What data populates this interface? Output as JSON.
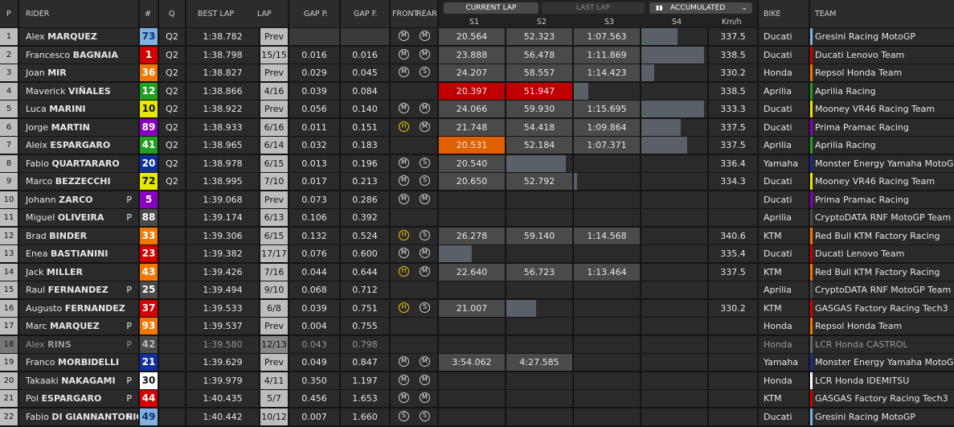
{
  "header": {
    "pos": "P",
    "rider": "RIDER",
    "num": "#",
    "q": "Q",
    "best_lap": "BEST LAP",
    "lap": "LAP",
    "gap_p": "GAP P.",
    "gap_f": "GAP F.",
    "front": "FRONT",
    "rear": "REAR",
    "tab_current": "CURRENT LAP",
    "tab_last": "LAST LAP",
    "accumulated": "ACCUMULATED",
    "s1": "S1",
    "s2": "S2",
    "s3": "S3",
    "s4": "S4",
    "kmh": "Km/h",
    "bike": "BIKE",
    "team": "TEAM"
  },
  "rows": [
    {
      "p": "1",
      "first": "Alex",
      "last": "MARQUEZ",
      "pit": "",
      "num": "73",
      "num_bg": "#7fb2e0",
      "num_fg": "#10306a",
      "q": "Q2",
      "best": "1:38.782",
      "lap": "Prev",
      "gap_p": "",
      "gap_f": "",
      "front": "M",
      "rear": "M",
      "s1": "20.564",
      "s2": "52.323",
      "s3": "1:07.563",
      "s4_pct": 0.55,
      "kmh": "337.5",
      "bike": "Ducati",
      "team": "Gresini Racing MotoGP",
      "team_color": "#7fb2e0"
    },
    {
      "p": "2",
      "first": "Francesco",
      "last": "BAGNAIA",
      "pit": "",
      "num": "1",
      "num_bg": "#d40000",
      "num_fg": "#ffffff",
      "q": "Q2",
      "best": "1:38.798",
      "lap": "15/15",
      "gap_p": "0.016",
      "gap_f": "0.016",
      "front": "M",
      "rear": "M",
      "s1": "23.888",
      "s2": "56.478",
      "s3": "1:11.869",
      "s4_pct": 0.95,
      "kmh": "338.5",
      "bike": "Ducati",
      "team": "Ducati Lenovo Team",
      "team_color": "#d40000"
    },
    {
      "p": "3",
      "first": "Joan",
      "last": "MIR",
      "pit": "",
      "num": "36",
      "num_bg": "#f07800",
      "num_fg": "#ffffff",
      "q": "Q2",
      "best": "1:38.827",
      "lap": "Prev",
      "gap_p": "0.029",
      "gap_f": "0.045",
      "front": "M",
      "rear": "S",
      "s1": "24.207",
      "s2": "58.557",
      "s3": "1:14.423",
      "s4_pct": 0.2,
      "kmh": "330.2",
      "bike": "Honda",
      "team": "Repsol Honda Team",
      "team_color": "#f07800"
    },
    {
      "p": "4",
      "first": "Maverick",
      "last": "VIÑALES",
      "pit": "",
      "num": "12",
      "num_bg": "#20a020",
      "num_fg": "#ffffff",
      "q": "Q2",
      "best": "1:38.866",
      "lap": "4/16",
      "gap_p": "0.039",
      "gap_f": "0.084",
      "front": "",
      "rear": "",
      "s1": "20.397",
      "s2": "51.947",
      "s3": "",
      "s4_pct": 0,
      "s3_bar": 0.22,
      "s1_hl": "#c00000",
      "s2_hl": "#c00000",
      "kmh": "338.5",
      "bike": "Aprilia",
      "team": "Aprilia Racing",
      "team_color": "#20a020"
    },
    {
      "p": "5",
      "first": "Luca",
      "last": "MARINI",
      "pit": "",
      "num": "10",
      "num_bg": "#e6e600",
      "num_fg": "#111111",
      "q": "Q2",
      "best": "1:38.922",
      "lap": "Prev",
      "gap_p": "0.056",
      "gap_f": "0.140",
      "front": "M",
      "rear": "M",
      "s1": "24.066",
      "s2": "59.930",
      "s3": "1:15.695",
      "s4_pct": 0.95,
      "kmh": "333.3",
      "bike": "Ducati",
      "team": "Mooney VR46 Racing Team",
      "team_color": "#e6e600"
    },
    {
      "p": "6",
      "first": "Jorge",
      "last": "MARTIN",
      "pit": "",
      "num": "89",
      "num_bg": "#8a00c0",
      "num_fg": "#ffffff",
      "q": "Q2",
      "best": "1:38.933",
      "lap": "6/16",
      "gap_p": "0.011",
      "gap_f": "0.151",
      "front": "H",
      "rear": "M",
      "s1": "21.748",
      "s2": "54.418",
      "s3": "1:09.864",
      "s4_pct": 0.6,
      "kmh": "337.5",
      "bike": "Ducati",
      "team": "Prima Pramac Racing",
      "team_color": "#8a00c0"
    },
    {
      "p": "7",
      "first": "Aleix",
      "last": "ESPARGARO",
      "pit": "",
      "num": "41",
      "num_bg": "#20a020",
      "num_fg": "#ffffff",
      "q": "Q2",
      "best": "1:38.965",
      "lap": "6/14",
      "gap_p": "0.032",
      "gap_f": "0.183",
      "front": "",
      "rear": "",
      "s1": "20.531",
      "s2": "52.184",
      "s3": "1:07.371",
      "s4_pct": 0.7,
      "s1_hl": "#e06000",
      "kmh": "337.5",
      "bike": "Aprilia",
      "team": "Aprilia Racing",
      "team_color": "#20a020"
    },
    {
      "p": "8",
      "first": "Fabio",
      "last": "QUARTARARO",
      "pit": "",
      "num": "20",
      "num_bg": "#1030a0",
      "num_fg": "#ffffff",
      "q": "Q2",
      "best": "1:38.978",
      "lap": "6/15",
      "gap_p": "0.013",
      "gap_f": "0.196",
      "front": "M",
      "rear": "S",
      "s1": "20.540",
      "s2": "",
      "s3": "",
      "s4_pct": 0,
      "s2_bar": 0.9,
      "kmh": "336.4",
      "bike": "Yamaha",
      "team": "Monster Energy Yamaha MotoGP",
      "team_color": "#1030a0"
    },
    {
      "p": "9",
      "first": "Marco",
      "last": "BEZZECCHI",
      "pit": "",
      "num": "72",
      "num_bg": "#e6e600",
      "num_fg": "#111111",
      "q": "Q2",
      "best": "1:38.995",
      "lap": "7/10",
      "gap_p": "0.017",
      "gap_f": "0.213",
      "front": "M",
      "rear": "S",
      "s1": "20.650",
      "s2": "52.792",
      "s3": "",
      "s4_pct": 0,
      "s3_bar": 0.05,
      "kmh": "334.3",
      "bike": "Ducati",
      "team": "Mooney VR46 Racing Team",
      "team_color": "#e6e600"
    },
    {
      "p": "10",
      "first": "Johann",
      "last": "ZARCO",
      "pit": "P",
      "num": "5",
      "num_bg": "#8a00c0",
      "num_fg": "#ffffff",
      "q": "",
      "best": "1:39.068",
      "lap": "Prev",
      "gap_p": "0.073",
      "gap_f": "0.286",
      "front": "M",
      "rear": "M",
      "s1": "",
      "s2": "",
      "s3": "",
      "s4_pct": 0,
      "kmh": "",
      "bike": "Ducati",
      "team": "Prima Pramac Racing",
      "team_color": "#8a00c0"
    },
    {
      "p": "11",
      "first": "Miguel",
      "last": "OLIVEIRA",
      "pit": "P",
      "num": "88",
      "num_bg": "#4a4a4a",
      "num_fg": "#ffffff",
      "q": "",
      "best": "1:39.174",
      "lap": "6/13",
      "gap_p": "0.106",
      "gap_f": "0.392",
      "front": "",
      "rear": "",
      "s1": "",
      "s2": "",
      "s3": "",
      "s4_pct": 0,
      "kmh": "",
      "bike": "Aprilia",
      "team": "CryptoDATA RNF MotoGP Team",
      "team_color": "#4a4a4a"
    },
    {
      "p": "12",
      "first": "Brad",
      "last": "BINDER",
      "pit": "",
      "num": "33",
      "num_bg": "#f07800",
      "num_fg": "#ffffff",
      "q": "",
      "best": "1:39.306",
      "lap": "6/15",
      "gap_p": "0.132",
      "gap_f": "0.524",
      "front": "H",
      "rear": "S",
      "s1": "26.278",
      "s2": "59.140",
      "s3": "1:14.568",
      "s4_pct": 0,
      "kmh": "340.6",
      "bike": "KTM",
      "team": "Red Bull KTM Factory Racing",
      "team_color": "#f07800"
    },
    {
      "p": "13",
      "first": "Enea",
      "last": "BASTIANINI",
      "pit": "",
      "num": "23",
      "num_bg": "#d40000",
      "num_fg": "#ffffff",
      "q": "",
      "best": "1:39.382",
      "lap": "17/17",
      "gap_p": "0.076",
      "gap_f": "0.600",
      "front": "M",
      "rear": "M",
      "s1": "",
      "s2": "",
      "s3": "",
      "s4_pct": 0,
      "s1_bar": 0.5,
      "kmh": "335.4",
      "bike": "Ducati",
      "team": "Ducati Lenovo Team",
      "team_color": "#d40000"
    },
    {
      "p": "14",
      "first": "Jack",
      "last": "MILLER",
      "pit": "",
      "num": "43",
      "num_bg": "#f07800",
      "num_fg": "#ffffff",
      "q": "",
      "best": "1:39.426",
      "lap": "7/16",
      "gap_p": "0.044",
      "gap_f": "0.644",
      "front": "H",
      "rear": "M",
      "s1": "22.640",
      "s2": "56.723",
      "s3": "1:13.464",
      "s4_pct": 0,
      "kmh": "337.5",
      "bike": "KTM",
      "team": "Red Bull KTM Factory Racing",
      "team_color": "#f07800"
    },
    {
      "p": "15",
      "first": "Raul",
      "last": "FERNANDEZ",
      "pit": "P",
      "num": "25",
      "num_bg": "#4a4a4a",
      "num_fg": "#ffffff",
      "q": "",
      "best": "1:39.494",
      "lap": "9/10",
      "gap_p": "0.068",
      "gap_f": "0.712",
      "front": "",
      "rear": "",
      "s1": "",
      "s2": "",
      "s3": "",
      "s4_pct": 0,
      "kmh": "",
      "bike": "Aprilia",
      "team": "CryptoDATA RNF MotoGP Team",
      "team_color": "#4a4a4a"
    },
    {
      "p": "16",
      "first": "Augusto",
      "last": "FERNANDEZ",
      "pit": "",
      "num": "37",
      "num_bg": "#d40000",
      "num_fg": "#ffffff",
      "q": "",
      "best": "1:39.533",
      "lap": "6/8",
      "gap_p": "0.039",
      "gap_f": "0.751",
      "front": "H",
      "rear": "S",
      "s1": "21.007",
      "s2": "",
      "s3": "",
      "s4_pct": 0,
      "s2_bar": 0.45,
      "kmh": "330.2",
      "bike": "KTM",
      "team": "GASGAS Factory Racing Tech3",
      "team_color": "#d40000"
    },
    {
      "p": "17",
      "first": "Marc",
      "last": "MARQUEZ",
      "pit": "P",
      "num": "93",
      "num_bg": "#f07800",
      "num_fg": "#ffffff",
      "q": "",
      "best": "1:39.537",
      "lap": "Prev",
      "gap_p": "0.004",
      "gap_f": "0.755",
      "front": "",
      "rear": "",
      "s1": "",
      "s2": "",
      "s3": "",
      "s4_pct": 0,
      "kmh": "",
      "bike": "Honda",
      "team": "Repsol Honda Team",
      "team_color": "#f07800"
    },
    {
      "p": "18",
      "first": "Alex",
      "last": "RINS",
      "pit": "P",
      "num": "42",
      "num_bg": "#4a4a4a",
      "num_fg": "#bbbbbb",
      "q": "",
      "best": "1:39.580",
      "lap": "12/13",
      "gap_p": "0.043",
      "gap_f": "0.798",
      "front": "",
      "rear": "",
      "s1": "",
      "s2": "",
      "s3": "",
      "s4_pct": 0,
      "kmh": "",
      "bike": "Honda",
      "team": "LCR Honda CASTROL",
      "team_color": "#666666",
      "dim": true
    },
    {
      "p": "19",
      "first": "Franco",
      "last": "MORBIDELLI",
      "pit": "",
      "num": "21",
      "num_bg": "#1030a0",
      "num_fg": "#ffffff",
      "q": "",
      "best": "1:39.629",
      "lap": "Prev",
      "gap_p": "0.049",
      "gap_f": "0.847",
      "front": "M",
      "rear": "M",
      "s1": "3:54.062",
      "s2": "4:27.585",
      "s3": "",
      "s4_pct": 0,
      "kmh": "",
      "bike": "Yamaha",
      "team": "Monster Energy Yamaha MotoGP",
      "team_color": "#1030a0"
    },
    {
      "p": "20",
      "first": "Takaaki",
      "last": "NAKAGAMI",
      "pit": "P",
      "num": "30",
      "num_bg": "#ffffff",
      "num_fg": "#111111",
      "q": "",
      "best": "1:39.979",
      "lap": "4/11",
      "gap_p": "0.350",
      "gap_f": "1.197",
      "front": "M",
      "rear": "M",
      "s1": "",
      "s2": "",
      "s3": "",
      "s4_pct": 0,
      "kmh": "",
      "bike": "Honda",
      "team": "LCR Honda IDEMITSU",
      "team_color": "#ffffff"
    },
    {
      "p": "21",
      "first": "Pol",
      "last": "ESPARGARO",
      "pit": "P",
      "num": "44",
      "num_bg": "#d40000",
      "num_fg": "#ffffff",
      "q": "",
      "best": "1:40.435",
      "lap": "5/7",
      "gap_p": "0.456",
      "gap_f": "1.653",
      "front": "M",
      "rear": "M",
      "s1": "",
      "s2": "",
      "s3": "",
      "s4_pct": 0,
      "kmh": "",
      "bike": "KTM",
      "team": "GASGAS Factory Racing Tech3",
      "team_color": "#d40000"
    },
    {
      "p": "22",
      "first": "Fabio",
      "last": "DI GIANNANTONIO",
      "pit": "P",
      "num": "49",
      "num_bg": "#7fb2e0",
      "num_fg": "#10306a",
      "q": "",
      "best": "1:40.442",
      "lap": "10/12",
      "gap_p": "0.007",
      "gap_f": "1.660",
      "front": "S",
      "rear": "S",
      "s1": "",
      "s2": "",
      "s3": "",
      "s4_pct": 0,
      "kmh": "",
      "bike": "Ducati",
      "team": "Gresini Racing MotoGP",
      "team_color": "#7fb2e0"
    }
  ]
}
